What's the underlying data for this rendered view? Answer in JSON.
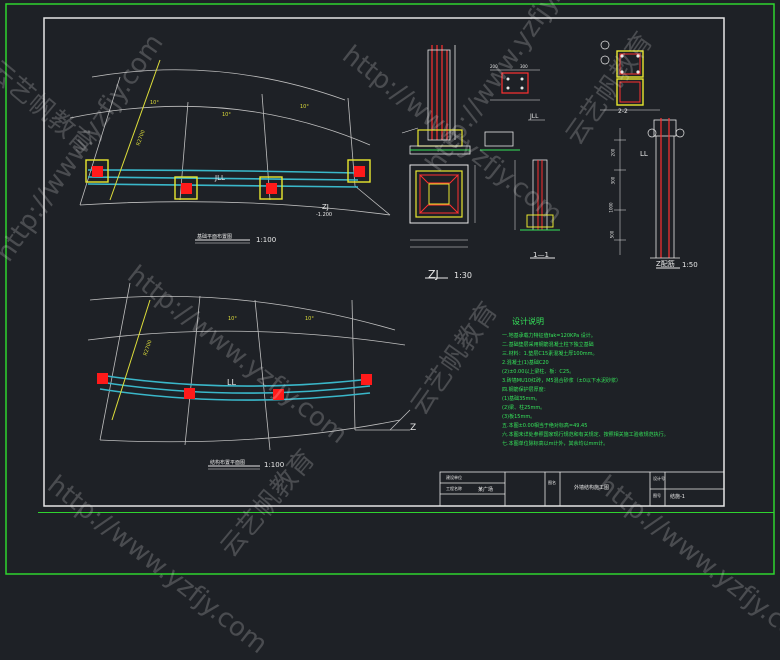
{
  "colors": {
    "background": "#1e2126",
    "frame": "#2fd42f",
    "border_white": "#e6e6e6",
    "wall": "#3ab7c9",
    "column": "#ff1a1a",
    "column_frame": "#e8e830",
    "dim_yellow": "#dede3a",
    "red_line": "#ff3030",
    "text_green": "#35e35a",
    "text_white": "#e8e8e8",
    "text_cyan": "#4fd0e0"
  },
  "plan_top": {
    "title": "基础平面布置图",
    "scale": "1:100",
    "beam_label": "JLL",
    "detail_label": "ZJ",
    "elev": "-1.200",
    "radius_label": "R2700",
    "angle_labels": [
      "10°",
      "10°",
      "10°"
    ]
  },
  "plan_bottom": {
    "title": "结构布置平面图",
    "scale": "1:100",
    "beam_label": "LL",
    "axis_label": "Z",
    "radius_label": "R2700",
    "angle_labels": [
      "10°",
      "10°"
    ]
  },
  "details": {
    "zj_label": "ZJ",
    "zj_scale": "1:30",
    "jll_label": "JLL",
    "section_11": "1—1",
    "z_detail_label": "Z配筋",
    "z_detail_scale": "1:50",
    "section_22": "2-2",
    "ll_label": "LL",
    "dims_small": [
      "200",
      "300",
      "1000",
      "500",
      "200",
      "300"
    ]
  },
  "notes": {
    "title": "设计说明",
    "lines": [
      "一.地基承载力特征值fak=120KPa 设计。",
      "二.基础垫层采用钢筋混凝土柱下独立基础",
      "三.材料：1.垫层C15素混凝土厚100mm。",
      "   2.混凝土(1)基础C20",
      "       (2)±0.00以上梁柱、板：C25。",
      "   3.砖墙MU10红砖，M5混合砂浆（±0以下水泥砂浆）",
      "四.钢筋保护层厚度：",
      "   (1)基础35mm。",
      "   (2)梁、柱25mm。",
      "   (3)板15mm。",
      "五.本图±0.00相当于绝对标高=49.45",
      "六.本图未详处参照国家现行规范和有关规定、按照相关施工验收规范执行。",
      "七.本图单位除标高以m计外，其余均以mm计。"
    ]
  },
  "title_block": {
    "cell_a1": "建设单位",
    "cell_a2": "工程名称",
    "cell_b": "某广场",
    "cell_c": "图名",
    "drawing_name": "外墙结构施工图",
    "cell_d1": "设计号",
    "cell_d2": "图号",
    "drawing_no": "结施-1"
  },
  "watermark": {
    "url": "http://www.yzfjy.com",
    "brand": "云艺帆教育"
  }
}
